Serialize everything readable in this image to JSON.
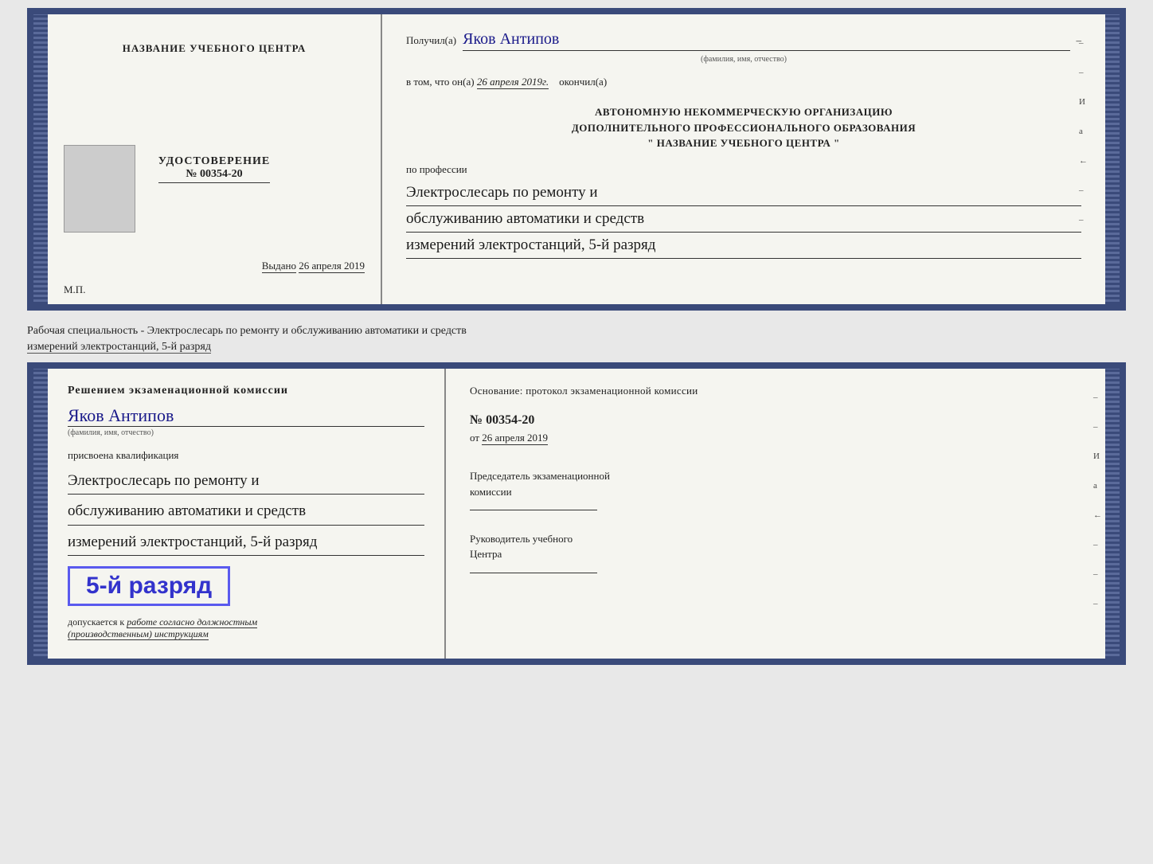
{
  "certificate": {
    "left": {
      "training_center_label": "НАЗВАНИЕ УЧЕБНОГО ЦЕНТРА",
      "udostoverenie_title": "УДОСТОВЕРЕНИЕ",
      "udostoverenie_number": "№ 00354-20",
      "vydano_label": "Выдано",
      "vydano_date": "26 апреля 2019",
      "mp_label": "М.П."
    },
    "right": {
      "recipient_label": "Получил(а)",
      "recipient_name": "Яков Антипов",
      "fio_hint": "(фамилия, имя, отчество)",
      "date_prefix": "в том, что он(а)",
      "date_value": "26 апреля 2019г.",
      "date_suffix": "окончил(а)",
      "org_line1": "АВТОНОМНУЮ НЕКОММЕРЧЕСКУЮ ОРГАНИЗАЦИЮ",
      "org_line2": "ДОПОЛНИТЕЛЬНОГО ПРОФЕССИОНАЛЬНОГО ОБРАЗОВАНИЯ",
      "org_line3": "\"  НАЗВАНИЕ УЧЕБНОГО ЦЕНТРА  \"",
      "profession_label": "по профессии",
      "profession_line1": "Электрослесарь по ремонту и",
      "profession_line2": "обслуживанию автоматики и средств",
      "profession_line3": "измерений электростанций, 5-й разряд"
    }
  },
  "specialty_text": {
    "main": "Рабочая специальность - Электрослесарь по ремонту и обслуживанию автоматики и средств",
    "secondary": "измерений электростанций, 5-й разряд"
  },
  "bottom": {
    "left": {
      "decision_text": "Решением  экзаменационной  комиссии",
      "person_name": "Яков Антипов",
      "fio_hint": "(фамилия, имя, отчество)",
      "qualification_label": "присвоена квалификация",
      "qualification_line1": "Электрослесарь по ремонту и",
      "qualification_line2": "обслуживанию автоматики и средств",
      "qualification_line3": "измерений электростанций, 5-й разряд",
      "razryad_badge": "5-й разряд",
      "допускается_prefix": "допускается к",
      "допускается_text": "работе согласно должностным",
      "инструкциям_text": "(производственным) инструкциям"
    },
    "right": {
      "osnovaniye_text": "Основание:  протокол  экзаменационной  комиссии",
      "number_label": "№  00354-20",
      "date_prefix": "от",
      "date_value": "26 апреля 2019",
      "chairman_title": "Председатель экзаменационной",
      "chairman_subtitle": "комиссии",
      "head_title": "Руководитель учебного",
      "head_subtitle": "Центра"
    }
  },
  "side_marks": {
    "top": [
      "И",
      "а",
      "←"
    ]
  }
}
